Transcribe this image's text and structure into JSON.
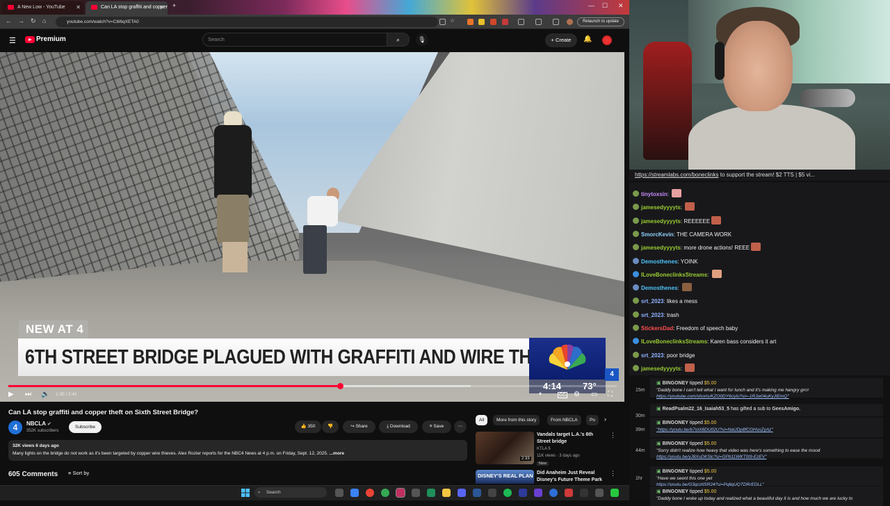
{
  "browser": {
    "tabs": [
      {
        "title": "A New Low - YouTube"
      },
      {
        "title": "Can LA stop graffiti and copper"
      }
    ],
    "url": "youtube.com/watch?v=Ctti6qXETA0",
    "relaunch_label": "Relaunch to update"
  },
  "youtube": {
    "brand": "Premium",
    "search_placeholder": "Search",
    "create_label": "Create"
  },
  "video": {
    "overlay_tag": "NEW AT 4",
    "headline": "6TH STREET BRIDGE PLAGUED WITH GRAFFITI AND WIRE THEFT",
    "bug_time": "4:14",
    "bug_temp": "73°",
    "bug_channel": "4",
    "time_current": "1:30",
    "time_total": "2:41",
    "time_display": "1:30 / 2:41",
    "progress": 0.545,
    "buffered": 0.76
  },
  "details": {
    "title": "Can LA stop graffiti and copper theft on Sixth Street Bridge?",
    "channel": "NBCLA",
    "channel_initial": "4",
    "subscribers": "352K subscribers",
    "subscribe_label": "Subscribe",
    "likes": "350",
    "share_label": "Share",
    "download_label": "Download",
    "save_label": "Save",
    "meta": "32K views  6 days ago",
    "description": "Many lights on the bridge do not work as it's been targeted by copper wire thieves. Alex Rozier reports for the NBC4 News at 4 p.m. on Friday, Sept. 12, 2025.",
    "more_label": "...more",
    "comments_count": "605 Comments",
    "sort_label": "Sort by"
  },
  "related": {
    "chips": [
      "All",
      "More from this story",
      "From NBCLA",
      "Po"
    ],
    "items": [
      {
        "title": "Vandals target L.A.'s 6th Street bridge",
        "channel": "KTLA 5",
        "views": "11K views · 3 days ago",
        "badge": "New",
        "duration": "2:33"
      },
      {
        "title": "Did Anaheim Just Reveal Disney's Future Theme Park ...",
        "thumb_text": "DISNEY'S REAL PLAN"
      }
    ]
  },
  "stream": {
    "ticker_link": "https://streamlabs.com/boneclinks",
    "ticker_text": " to support the stream! $2 TTS | $5 vi...",
    "chat": [
      {
        "user": "tinytoxsin",
        "color": "#c58af9",
        "text": "",
        "emote": "#e8a0a0",
        "badge": "#7a9a4a"
      },
      {
        "user": "jamesedyyyyts",
        "color": "#9acd32",
        "text": "",
        "emote": "#c0604a",
        "badge": "#7a9a4a"
      },
      {
        "user": "jamesedyyyyts",
        "color": "#9acd32",
        "text": "REEEEEE",
        "emote": "#c0604a",
        "badge": "#7a9a4a"
      },
      {
        "user": "SmorcKevin",
        "color": "#8fd3ff",
        "text": "THE CAMERA WORK",
        "emote": "",
        "badge": "#7a9a4a"
      },
      {
        "user": "jamesedyyyyts",
        "color": "#9acd32",
        "text": "more drone actions! REEE",
        "emote": "#c0604a",
        "badge": "#7a9a4a"
      },
      {
        "user": "Demosthenes",
        "color": "#4fc3f7",
        "text": "YOINK",
        "emote": "",
        "badge": "#6a8cc0"
      },
      {
        "user": "ILoveBoneclinksStreams",
        "color": "#9acd32",
        "text": "",
        "emote": "#e0a080",
        "badge": "#3b8fe0"
      },
      {
        "user": "Demosthenes",
        "color": "#4fc3f7",
        "text": "",
        "emote": "#8a6040",
        "badge": "#6a8cc0"
      },
      {
        "user": "srt_2023",
        "color": "#8fb4ff",
        "text": "likes a mess",
        "emote": "",
        "badge": "#7a9a4a"
      },
      {
        "user": "srt_2023",
        "color": "#8fb4ff",
        "text": "trash",
        "emote": "",
        "badge": "#7a9a4a"
      },
      {
        "user": "StickersDad",
        "color": "#ff4d4d",
        "text": "Freedom of speech baby",
        "emote": "",
        "badge": "#7a9a4a"
      },
      {
        "user": "ILoveBoneclinksStreams",
        "color": "#9acd32",
        "text": "Karen bass considers it art",
        "emote": "",
        "badge": "#3b8fe0"
      },
      {
        "user": "srt_2023",
        "color": "#8fb4ff",
        "text": "poor bridge",
        "emote": "",
        "badge": "#7a9a4a"
      },
      {
        "user": "jamesedyyyyts",
        "color": "#9acd32",
        "text": "",
        "emote": "#c0604a",
        "badge": "#7a9a4a"
      }
    ],
    "events": [
      {
        "time": "15m",
        "name": "BINGONEY",
        "action": "tipped",
        "amount": "$5.00",
        "msg": "\"Daddy bone I can't tell what I want for lunch and it's making me hangry grrrr",
        "link": "https://youtube.com/shorts/KZO0DY6cyIo?si=-1RJw04uKyJIEmQ\""
      },
      {
        "time": "30m",
        "name": "ReadPsalm22_16_Isaiah53_5",
        "action": "has gifted a sub to",
        "target": "GeesAmigo."
      },
      {
        "time": "39m",
        "name": "BINGONEY",
        "action": "tipped",
        "amount": "$5.00",
        "link": "\"https://youtu.be/b7oIX8DU02U?si=NaUDp8fCGHsnZyAz\""
      },
      {
        "time": "44m",
        "name": "BINGONEY",
        "action": "tipped",
        "amount": "$5.00",
        "msg": "\"Sorry didn't realize how heavy that video was here's something to ease the mood",
        "link": "https://youtu.be/yJ8XuDKSlc?si=GPb11WKT0t9-EzEV\""
      },
      {
        "time": "1hr",
        "name": "BINGONEY",
        "action": "tipped",
        "amount": "$5.00",
        "msg": "\"Have we seent this one yet",
        "link": "https://youtu.be/G3gcztlSR24?si=PqllgUQTDRrEDLL\""
      },
      {
        "time": "",
        "name": "BINGONEY",
        "action": "tipped",
        "amount": "$5.00",
        "msg": "\"Daddy bone I woke up today and realized what a beautiful day it is and how much we are lucky to"
      }
    ]
  },
  "taskbar": {
    "search_placeholder": "Search"
  }
}
